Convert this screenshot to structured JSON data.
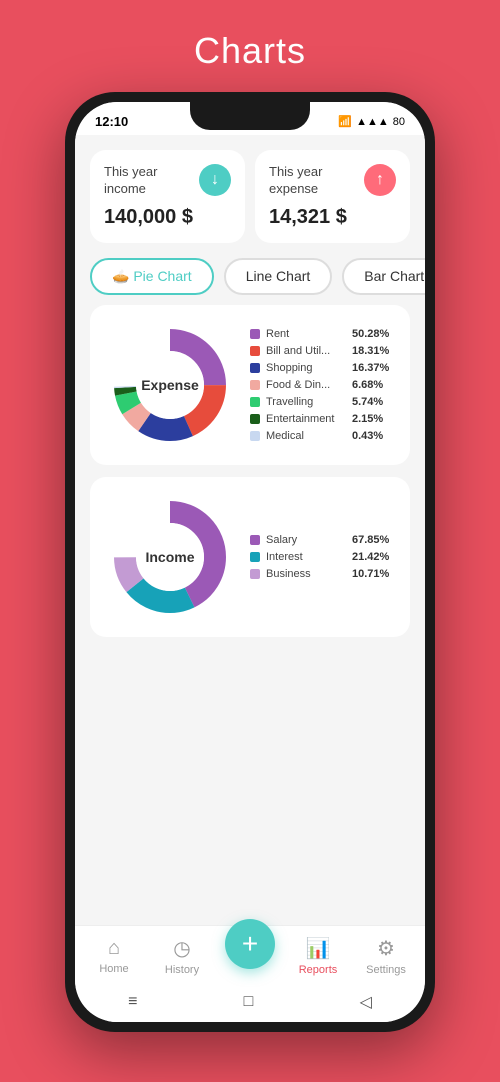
{
  "page": {
    "title": "Charts",
    "background_color": "#e84f5e"
  },
  "status_bar": {
    "time": "12:10",
    "icons": "● ▲▲▲ 80"
  },
  "income_card": {
    "label": "This year income",
    "amount": "140,000 $",
    "icon_type": "down",
    "icon_color": "#4ecdc4"
  },
  "expense_card": {
    "label": "This year expense",
    "amount": "14,321 $",
    "icon_type": "up",
    "icon_color": "#ff6b7a"
  },
  "chart_tabs": [
    {
      "label": "🥧 Pie Chart",
      "active": true
    },
    {
      "label": "Line Chart",
      "active": false
    },
    {
      "label": "Bar Chart",
      "active": false
    }
  ],
  "expense_chart": {
    "title": "Expense",
    "legend": [
      {
        "name": "Rent",
        "pct": "50.28%",
        "color": "#9b59b6"
      },
      {
        "name": "Bill and Util...",
        "pct": "18.31%",
        "color": "#e74c3c"
      },
      {
        "name": "Shopping",
        "pct": "16.37%",
        "color": "#2c3e9e"
      },
      {
        "name": "Food & Din...",
        "pct": "6.68%",
        "color": "#f1a9a0"
      },
      {
        "name": "Travelling",
        "pct": "5.74%",
        "color": "#2ecc71"
      },
      {
        "name": "Entertainment",
        "pct": "2.15%",
        "color": "#1a5e1a"
      },
      {
        "name": "Medical",
        "pct": "0.43%",
        "color": "#c8d8f0"
      }
    ]
  },
  "income_chart": {
    "title": "Income",
    "legend": [
      {
        "name": "Salary",
        "pct": "67.85%",
        "color": "#9b59b6"
      },
      {
        "name": "Interest",
        "pct": "21.42%",
        "color": "#17a2b8"
      },
      {
        "name": "Business",
        "pct": "10.71%",
        "color": "#c39bd3"
      }
    ]
  },
  "bottom_nav": {
    "items": [
      {
        "label": "Home",
        "icon": "⌂",
        "active": false
      },
      {
        "label": "History",
        "icon": "◷",
        "active": false
      },
      {
        "label": "Reports",
        "icon": "📊",
        "active": true
      },
      {
        "label": "Settings",
        "icon": "⚙",
        "active": false
      }
    ],
    "fab_label": "+"
  },
  "system_nav": {
    "icons": [
      "≡",
      "□",
      "◁"
    ]
  }
}
